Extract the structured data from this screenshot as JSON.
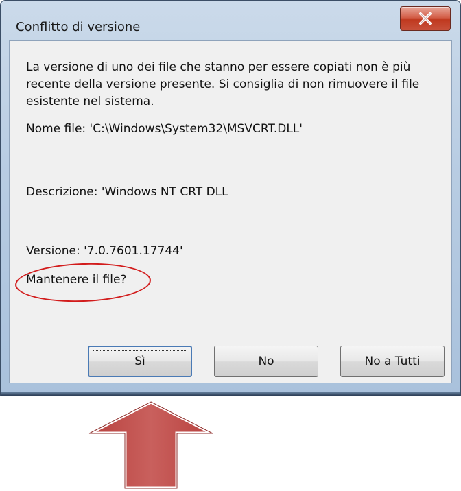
{
  "window": {
    "title": "Conflitto di versione"
  },
  "icons": {
    "close": "close-icon",
    "arrow": "arrow-up-icon"
  },
  "message": {
    "line1": "La versione di uno dei file che stanno per essere copiati non è più",
    "line2": "recente della versione presente. Si consiglia di non rimuovere il file",
    "line3": "esistente nel sistema."
  },
  "details": {
    "filename": "Nome file:   'C:\\Windows\\System32\\MSVCRT.DLL'",
    "description": "Descrizione:  'Windows NT CRT DLL",
    "version": "Versione: '7.0.7601.17744'",
    "question": "Mantenere il file?"
  },
  "buttons": {
    "yes_prefix": "",
    "yes_access": "S",
    "yes_suffix": "ì",
    "no_access": "N",
    "no_suffix": "o",
    "noall_prefix": "No a ",
    "noall_access": "T",
    "noall_suffix": "utti"
  },
  "colors": {
    "annotation": "#d21c1c",
    "arrow_fill": "#c0504d",
    "close_button": "#c7503a"
  }
}
